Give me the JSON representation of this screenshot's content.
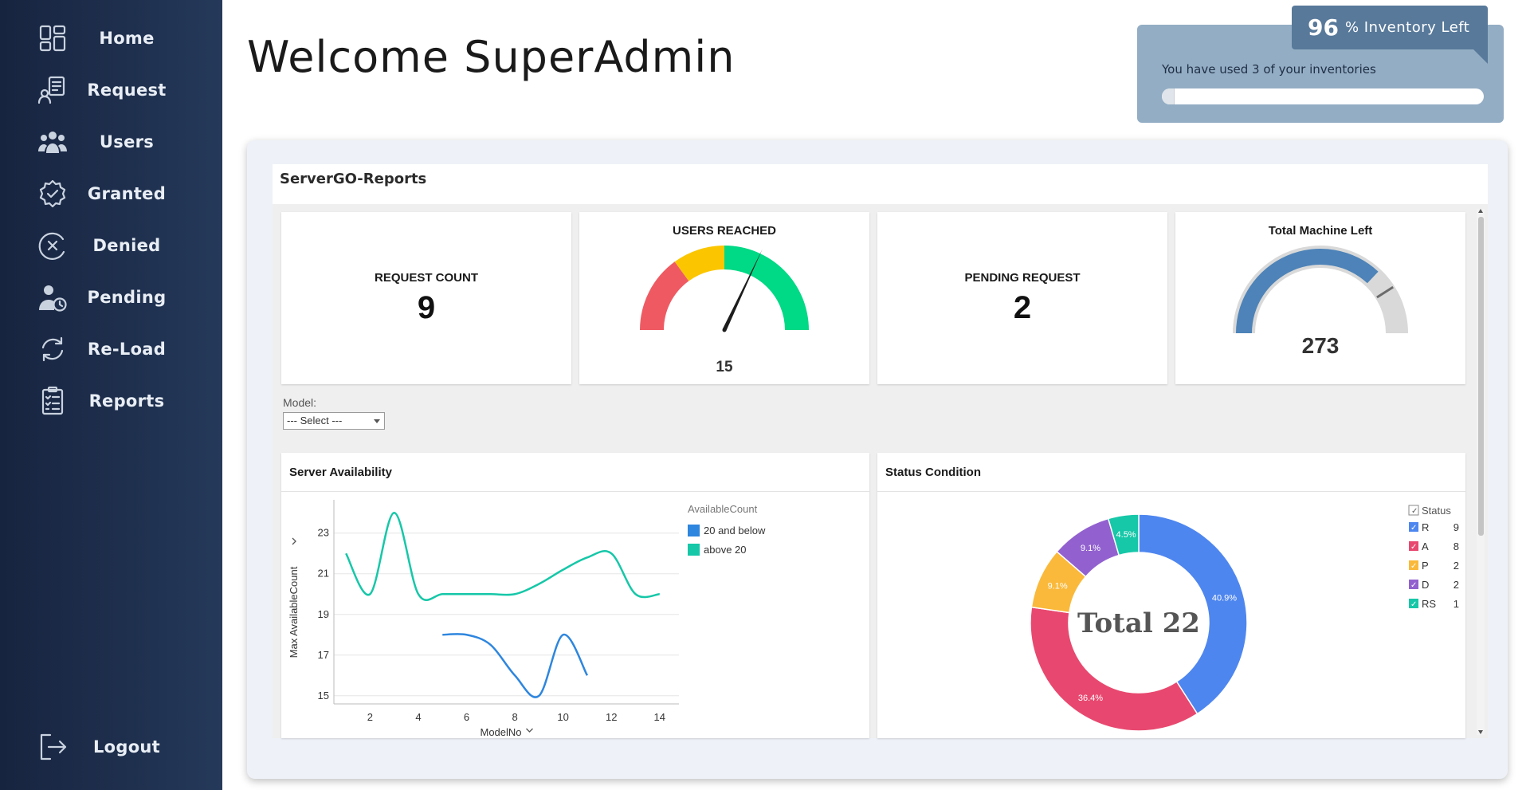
{
  "sidebar": {
    "items": [
      {
        "label": "Home",
        "icon": "dashboard-icon"
      },
      {
        "label": "Request",
        "icon": "request-form-icon"
      },
      {
        "label": "Users",
        "icon": "users-group-icon"
      },
      {
        "label": "Granted",
        "icon": "verified-badge-icon"
      },
      {
        "label": "Denied",
        "icon": "circle-x-icon"
      },
      {
        "label": "Pending",
        "icon": "user-clock-icon"
      },
      {
        "label": "Re-Load",
        "icon": "reload-icon"
      },
      {
        "label": "Reports",
        "icon": "clipboard-checklist-icon"
      }
    ],
    "logout": {
      "label": "Logout",
      "icon": "logout-icon"
    }
  },
  "header": {
    "welcome": "Welcome SuperAdmin"
  },
  "inventory": {
    "percent": "96",
    "badge_text": "% Inventory Left",
    "used_text": "You have used 3 of your inventories",
    "used_fraction": 0.04
  },
  "reports": {
    "title": "ServerGO-Reports",
    "kpis": {
      "request_count": {
        "label": "REQUEST COUNT",
        "value": "9"
      },
      "users_reached": {
        "label": "USERS REACHED",
        "value": "15"
      },
      "pending_request": {
        "label": "PENDING REQUEST",
        "value": "2"
      },
      "total_machine_left": {
        "label": "Total Machine Left",
        "value": "273"
      }
    },
    "filter": {
      "label": "Model:",
      "value": "--- Select ---"
    },
    "server_availability_title": "Server Availability",
    "status_condition_title": "Status Condition"
  },
  "colors": {
    "sidebar_bg": "#1e2f4d",
    "gauge_red": "#ef5a62",
    "gauge_yellow": "#fbc600",
    "gauge_green": "#00d985",
    "machine_gauge": "#4d83b8",
    "series_low": "#2e86de",
    "series_high": "#16c7a8"
  },
  "chart_data": [
    {
      "type": "gauge",
      "title": "USERS REACHED",
      "value": 15,
      "segments": [
        "#ef5a62",
        "#fbc600",
        "#00d985"
      ],
      "needle_fraction": 0.64
    },
    {
      "type": "gauge",
      "title": "Total Machine Left",
      "value": 273,
      "fill_fraction": 0.74,
      "target_fraction": 0.82
    },
    {
      "type": "line",
      "title": "Server Availability",
      "xlabel": "ModelNo",
      "ylabel": "Max AvailableCount",
      "xlim": [
        0.5,
        14.8
      ],
      "ylim": [
        14.6,
        24.4
      ],
      "xticks": [
        2,
        4,
        6,
        8,
        10,
        12,
        14
      ],
      "yticks": [
        15,
        17,
        19,
        21,
        23
      ],
      "legend_title": "AvailableCount",
      "series": [
        {
          "name": "20 and below",
          "color": "#2e86de",
          "x": [
            5,
            6,
            7,
            8,
            9,
            10,
            11
          ],
          "y": [
            18,
            18,
            17.5,
            16,
            15,
            18,
            16
          ]
        },
        {
          "name": "above 20",
          "color": "#16c7a8",
          "x": [
            1,
            2,
            3,
            4,
            5,
            6,
            7,
            8,
            9,
            10,
            11,
            12,
            13,
            14
          ],
          "y": [
            22,
            20,
            24,
            20,
            20,
            20,
            20,
            20,
            20.5,
            21.2,
            21.8,
            22,
            20,
            20
          ]
        }
      ],
      "grid": true,
      "legend": "top-right"
    },
    {
      "type": "pie",
      "title": "Status Condition",
      "center_label": "Total 22",
      "legend_title": "Status",
      "legend": "top-right",
      "slices": [
        {
          "label": "R",
          "value": 9,
          "percent": "40.9%",
          "color": "#4e86ef"
        },
        {
          "label": "A",
          "value": 8,
          "percent": "36.4%",
          "color": "#e8486f"
        },
        {
          "label": "P",
          "value": 2,
          "percent": "9.1%",
          "color": "#fab93a"
        },
        {
          "label": "D",
          "value": 2,
          "percent": "9.1%",
          "color": "#9261cf"
        },
        {
          "label": "RS",
          "value": 1,
          "percent": "4.5%",
          "color": "#16c7a8"
        }
      ]
    }
  ]
}
